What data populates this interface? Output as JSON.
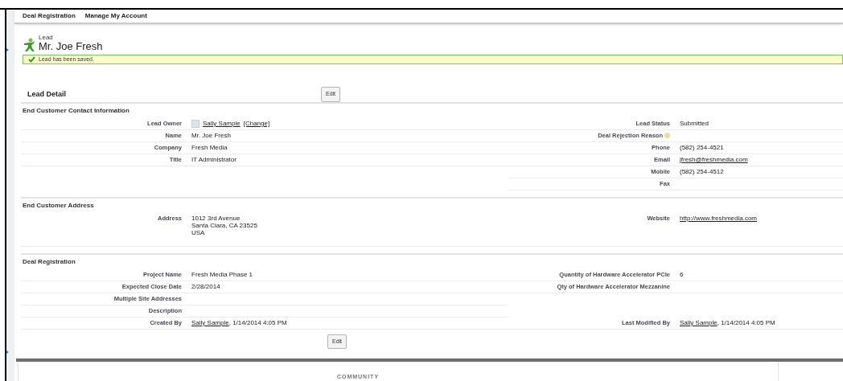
{
  "nav": [
    {
      "label": "Deal Registration"
    },
    {
      "label": "Manage My Account"
    }
  ],
  "header": {
    "object_type": "Lead",
    "title": "Mr. Joe Fresh"
  },
  "message": {
    "text": "Lead has been saved."
  },
  "detail": {
    "title": "Lead Detail",
    "edit_button": "Edit"
  },
  "sections": [
    {
      "title": "End Customer Contact Information",
      "rows": [
        {
          "left": {
            "label": "Lead Owner",
            "kind": "owner",
            "value": "Sally Sample",
            "action": "[Change]"
          },
          "right": {
            "label": "Lead Status",
            "kind": "text",
            "value": "Submitted"
          }
        },
        {
          "left": {
            "label": "Name",
            "kind": "text",
            "value": "Mr. Joe Fresh"
          },
          "right": {
            "label": "Deal Rejection Reason",
            "kind": "empty",
            "help": true
          }
        },
        {
          "left": {
            "label": "Company",
            "kind": "text",
            "value": "Fresh Media"
          },
          "right": {
            "label": "Phone",
            "kind": "text",
            "value": "(582) 254-4521"
          }
        },
        {
          "left": {
            "label": "Title",
            "kind": "text",
            "value": "IT Administrator"
          },
          "right": {
            "label": "Email",
            "kind": "link",
            "value": "jfresh@freshmedia.com"
          }
        },
        {
          "left": null,
          "right": {
            "label": "Mobile",
            "kind": "text",
            "value": "(582) 254-4512"
          }
        },
        {
          "left": null,
          "right": {
            "label": "Fax",
            "kind": "empty"
          }
        }
      ]
    },
    {
      "title": "End Customer Address",
      "rows": [
        {
          "left": {
            "label": "Address",
            "kind": "address",
            "lines": [
              "1012 3rd Avenue",
              "Santa Clara, CA 23525",
              "USA"
            ]
          },
          "right": {
            "label": "Website",
            "kind": "link",
            "value": "http://www.freshmedia.com"
          }
        }
      ]
    },
    {
      "title": "Deal Registration",
      "rows": [
        {
          "left": {
            "label": "Project Name",
            "kind": "text",
            "value": "Fresh Media Phase 1"
          },
          "right": {
            "label": "Quantity of Hardware Accelerator PCIe",
            "kind": "text",
            "value": "6"
          }
        },
        {
          "left": {
            "label": "Expected Close Date",
            "kind": "text",
            "value": "2/28/2014"
          },
          "right": {
            "label": "Qty of Hardware Accelerator Mezzanine",
            "kind": "empty"
          }
        },
        {
          "left": {
            "label": "Multiple Site Addresses",
            "kind": "empty"
          },
          "right": null
        },
        {
          "left": {
            "label": "Description",
            "kind": "empty"
          },
          "right": null
        },
        {
          "left": {
            "label": "Created By",
            "kind": "user_date",
            "value": "Sally Sample",
            "suffix": ", 1/14/2014 4:05 PM"
          },
          "right": {
            "label": "Last Modified By",
            "kind": "user_date",
            "value": "Sally Sample",
            "suffix": ", 1/14/2014 4:05 PM"
          }
        }
      ]
    }
  ],
  "bottom_edit_button": "Edit",
  "footer": {
    "title": "COMMUNITY"
  }
}
